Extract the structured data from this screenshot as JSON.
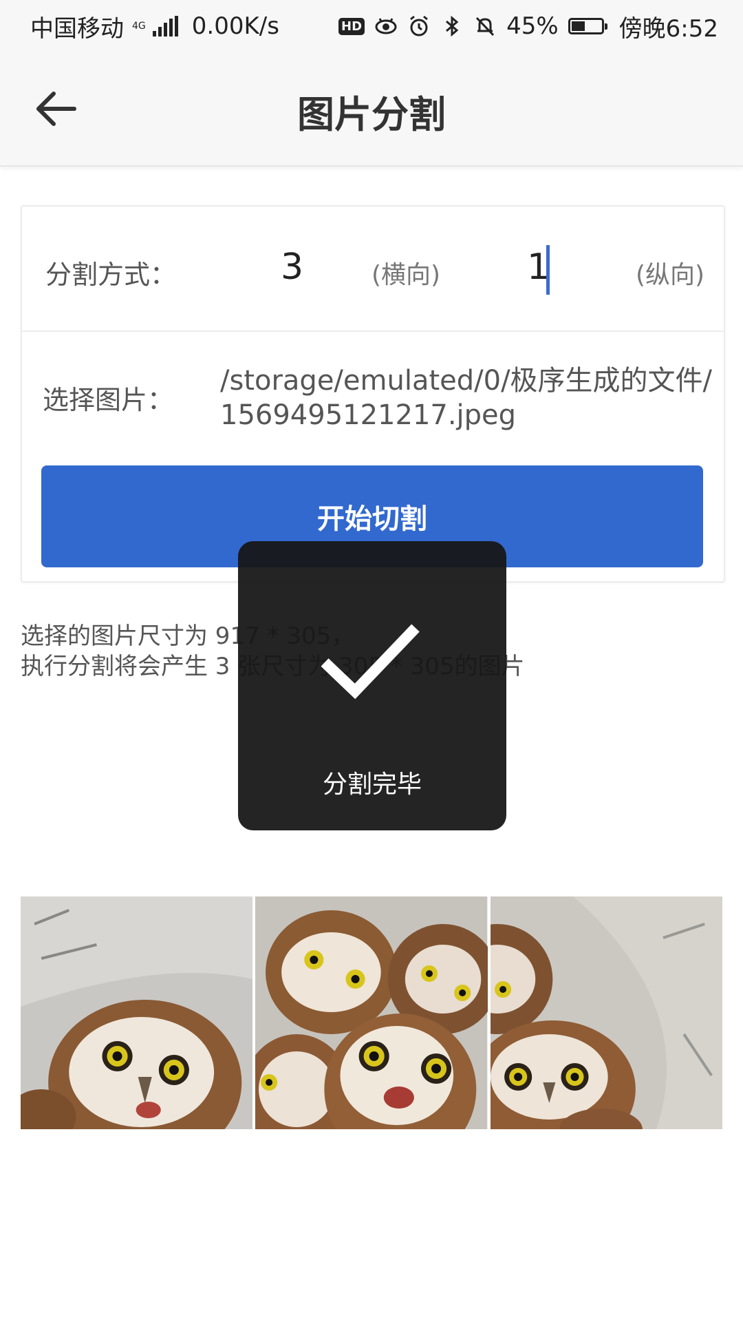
{
  "status_bar": {
    "carrier": "中国移动",
    "network": "4G",
    "speed": "0.00K/s",
    "hd": "HD",
    "battery_percent": "45%",
    "battery_level": 0.45,
    "time": "傍晚6:52"
  },
  "nav": {
    "back_icon": "arrow-left-icon",
    "title": "图片分割"
  },
  "form": {
    "mode_label": "分割方式：",
    "horizontal_value": "3",
    "horizontal_unit": "(横向)",
    "vertical_value": "1",
    "vertical_unit": "(纵向)",
    "image_label": "选择图片：",
    "image_path": "/storage/emulated/0/极序生成的文件/1569495121217.jpeg",
    "start_button": "开始切割"
  },
  "info": {
    "line1": "选择的图片尺寸为 917 * 305，",
    "line2": "执行分割将会产生 3 张尺寸为 305 * 305的图片"
  },
  "toast": {
    "icon": "checkmark-icon",
    "message": "分割完毕"
  },
  "slices": {
    "count": 3,
    "description_icon": "owl-photo"
  },
  "colors": {
    "accent": "#3269cf",
    "toast_bg": "#161616",
    "caret": "#3a6bd1"
  }
}
